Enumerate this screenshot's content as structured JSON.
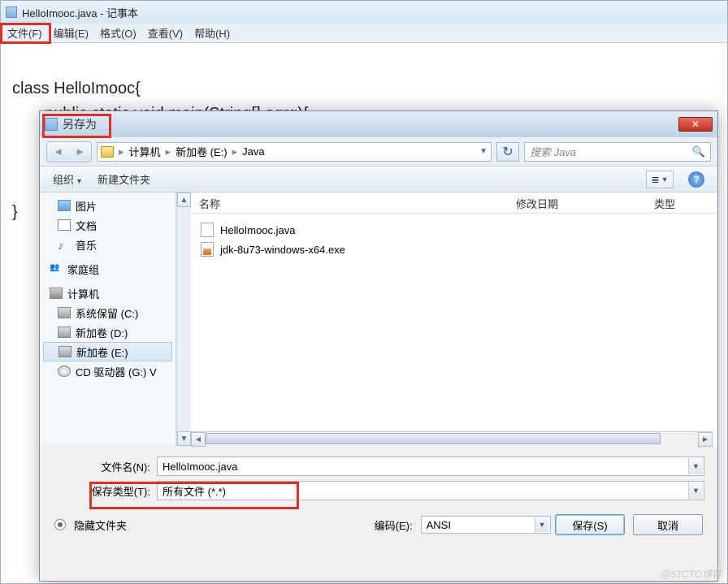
{
  "notepad": {
    "title": "HelloImooc.java - 记事本",
    "menu": {
      "file": "文件(F)",
      "edit": "编辑(E)",
      "format": "格式(O)",
      "view": "查看(V)",
      "help": "帮助(H)"
    },
    "code_line1": "class HelloImooc{",
    "code_line2": "public static void main(String[] agrg){",
    "code_line3": "}"
  },
  "dialog": {
    "title": "另存为",
    "close_x": "✕",
    "nav": {
      "seg1": "计算机",
      "seg2": "新加卷 (E:)",
      "seg3": "Java",
      "search_placeholder": "搜索 Java"
    },
    "toolbar": {
      "organize": "组织",
      "newfolder": "新建文件夹"
    },
    "sidebar": {
      "pictures": "图片",
      "documents": "文档",
      "music": "音乐",
      "homegroup": "家庭组",
      "computer": "计算机",
      "drive_c": "系统保留 (C:)",
      "drive_d": "新加卷 (D:)",
      "drive_e": "新加卷 (E:)",
      "drive_g": "CD 驱动器 (G:) V"
    },
    "columns": {
      "name": "名称",
      "date": "修改日期",
      "type": "类型"
    },
    "files": {
      "f1": "HelloImooc.java",
      "f2": "jdk-8u73-windows-x64.exe"
    },
    "filename_label": "文件名(N):",
    "filename_value": "HelloImooc.java",
    "filetype_label": "保存类型(T):",
    "filetype_value": "所有文件  (*.*)",
    "hide_folders": "隐藏文件夹",
    "encoding_label": "编码(E):",
    "encoding_value": "ANSI",
    "save_btn": "保存(S)",
    "cancel_btn": "取消"
  },
  "watermark": "@51CTO博客"
}
